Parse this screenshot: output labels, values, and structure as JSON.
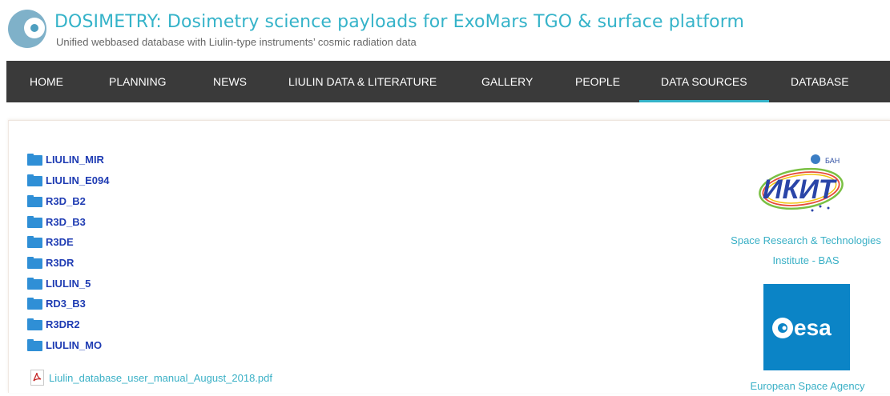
{
  "header": {
    "logo_icon": "site-logo-icon",
    "title": "DOSIMETRY: Dosimetry science payloads for ExoMars TGO & surface platform",
    "subtitle": "Unified webbased database with Liulin-type instruments’ cosmic radiation data"
  },
  "nav": {
    "items": [
      {
        "label": "HOME"
      },
      {
        "label": "PLANNING"
      },
      {
        "label": "NEWS"
      },
      {
        "label": "LIULIN DATA & LITERATURE"
      },
      {
        "label": "GALLERY"
      },
      {
        "label": "PEOPLE"
      },
      {
        "label": "DATA SOURCES",
        "active": true
      },
      {
        "label": "DATABASE"
      }
    ],
    "background_color": "#3a3a3a",
    "active_underline_color": "#35b3c9"
  },
  "folders": [
    {
      "label": "LIULIN_MIR"
    },
    {
      "label": "LIULIN_E094"
    },
    {
      "label": "R3D_B2"
    },
    {
      "label": "R3D_B3"
    },
    {
      "label": "R3DE"
    },
    {
      "label": "R3DR"
    },
    {
      "label": "LIULIN_5"
    },
    {
      "label": "RD3_B3"
    },
    {
      "label": "R3DR2"
    },
    {
      "label": "LIULIN_MO"
    }
  ],
  "file": {
    "icon": "pdf-file-icon",
    "label": "Liulin_database_user_manual_August_2018.pdf"
  },
  "sponsors": {
    "ikit": {
      "logo_text": "ИКИТ",
      "logo_badge": "БАН",
      "caption_line1": "Space Research & Technologies",
      "caption_line2": "Institute - BAS"
    },
    "esa": {
      "logo_text": "esa",
      "caption": "European Space Agency"
    }
  },
  "colors": {
    "title": "#35b3c9",
    "folder_icon": "#2f8fd6",
    "folder_link": "#1f3cb3",
    "link": "#3ab0c6",
    "esa_blue": "#0b84c6"
  }
}
